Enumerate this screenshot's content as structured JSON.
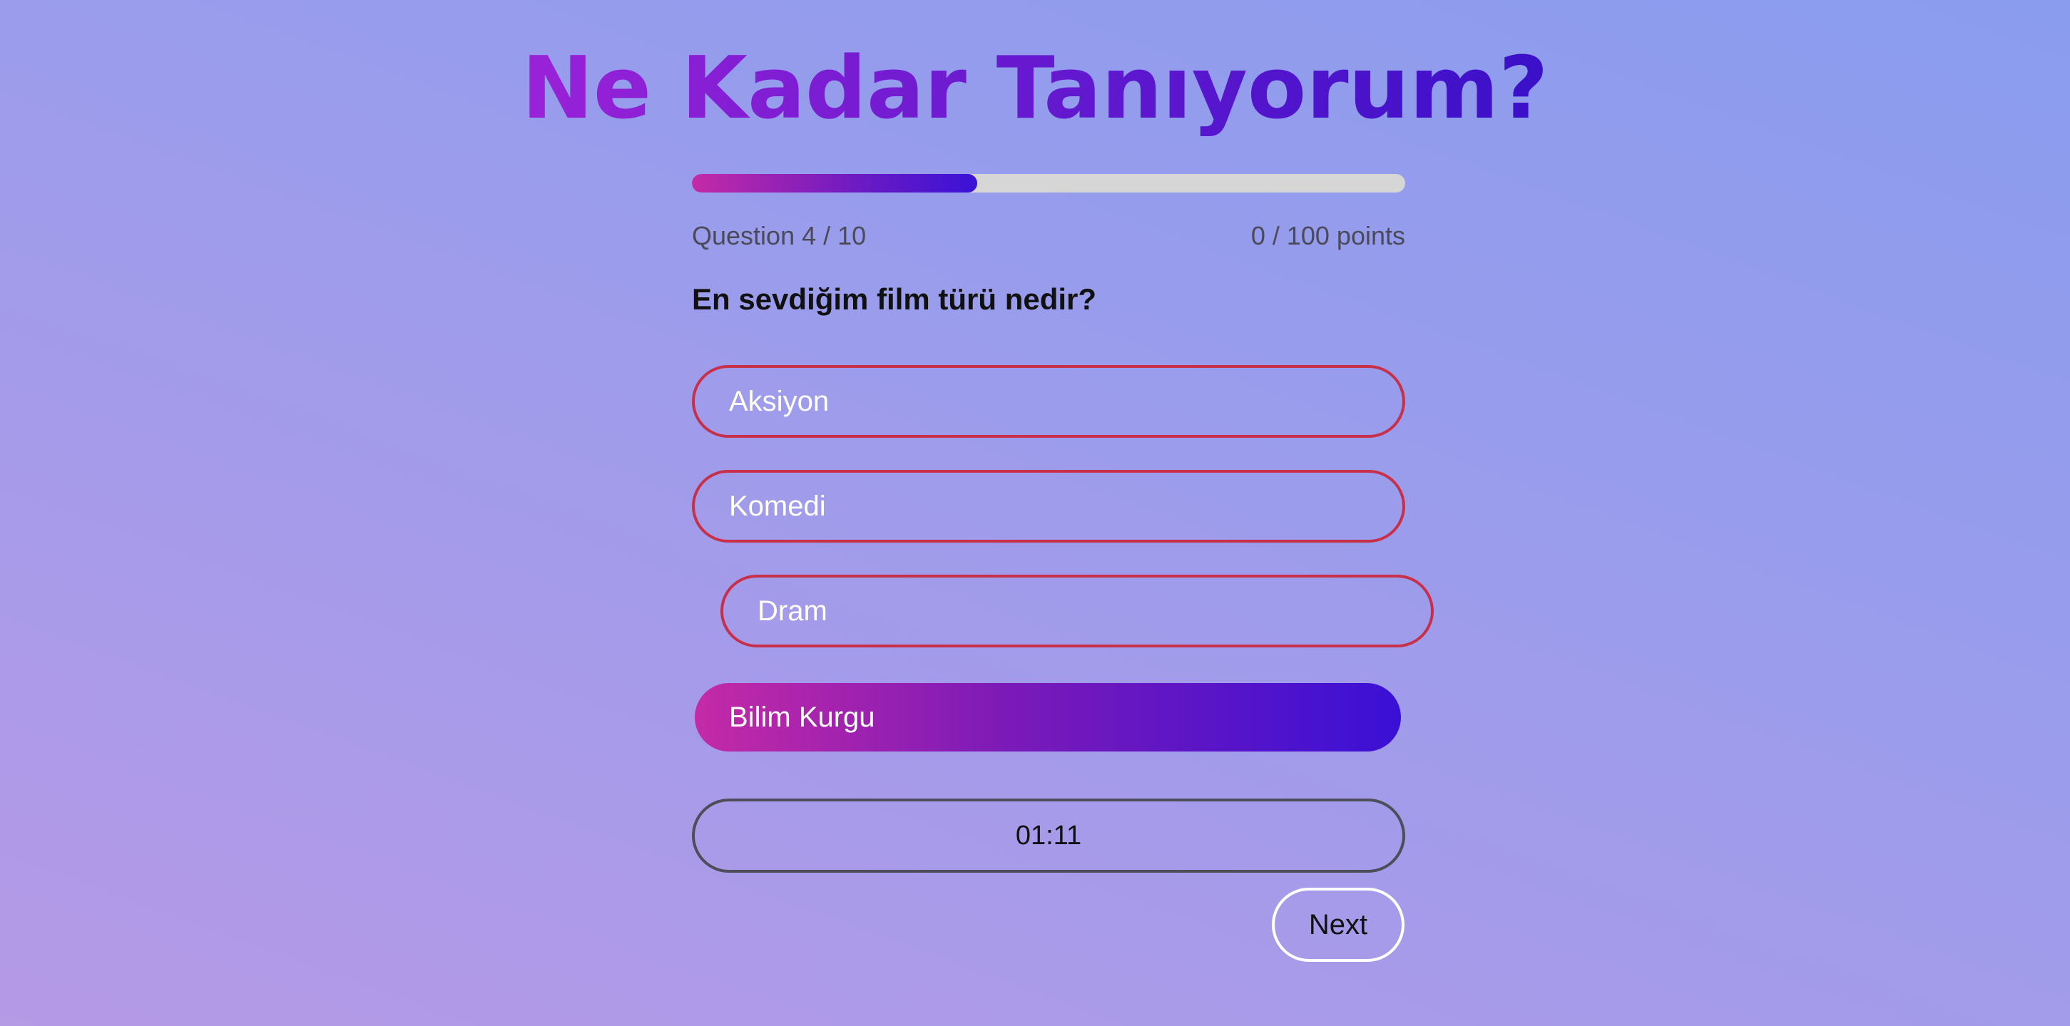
{
  "app": {
    "title": "Ne Kadar Tanıyorum?"
  },
  "progress": {
    "current": 4,
    "total": 10,
    "fraction": 0.4,
    "question_label": "Question 4 / 10",
    "points_label": "0 / 100 points"
  },
  "question": {
    "text": "En sevdiğim film türü nedir?"
  },
  "options": [
    {
      "label": "Aksiyon",
      "selected": false
    },
    {
      "label": "Komedi",
      "selected": false
    },
    {
      "label": "Dram",
      "selected": false
    },
    {
      "label": "Bilim Kurgu",
      "selected": true
    }
  ],
  "timer": {
    "value": "01:11"
  },
  "actions": {
    "next_label": "Next"
  },
  "colors": {
    "accent_start": "#c42aa6",
    "accent_end": "#3a10d6",
    "option_border": "#c8304a"
  }
}
